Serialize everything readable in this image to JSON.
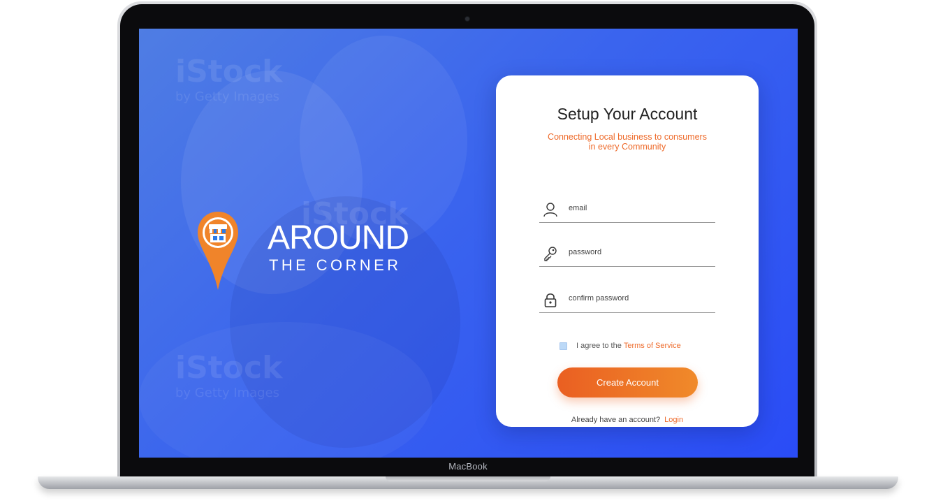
{
  "device": {
    "label": "MacBook"
  },
  "brand": {
    "logo_line1": "AROUND",
    "logo_line2": "THE CORNER",
    "pin_icon": "storefront-pin-icon",
    "accent_color": "#F0842A",
    "background_gradient": [
      "#4F7DE3",
      "#2A4CF6"
    ]
  },
  "watermarks": [
    {
      "line1": "iStock",
      "line2": "by Getty Images"
    },
    {
      "line1": "iStock",
      "line2": ""
    },
    {
      "line1": "iStock",
      "line2": "by Getty Images"
    }
  ],
  "form": {
    "title": "Setup Your Account",
    "subtitle_line1": "Connecting Local business to consumers",
    "subtitle_line2": "in every Community",
    "fields": [
      {
        "icon": "user-icon",
        "placeholder": "email",
        "value": ""
      },
      {
        "icon": "key-icon",
        "placeholder": "password",
        "value": ""
      },
      {
        "icon": "lock-icon",
        "placeholder": "confirm password",
        "value": ""
      }
    ],
    "agree_text": "I agree to the",
    "terms_link": "Terms of Service",
    "submit_label": "Create Account",
    "login_prompt": "Already have an account?",
    "login_link": "Login",
    "accent_color": "#EE6A2A"
  }
}
